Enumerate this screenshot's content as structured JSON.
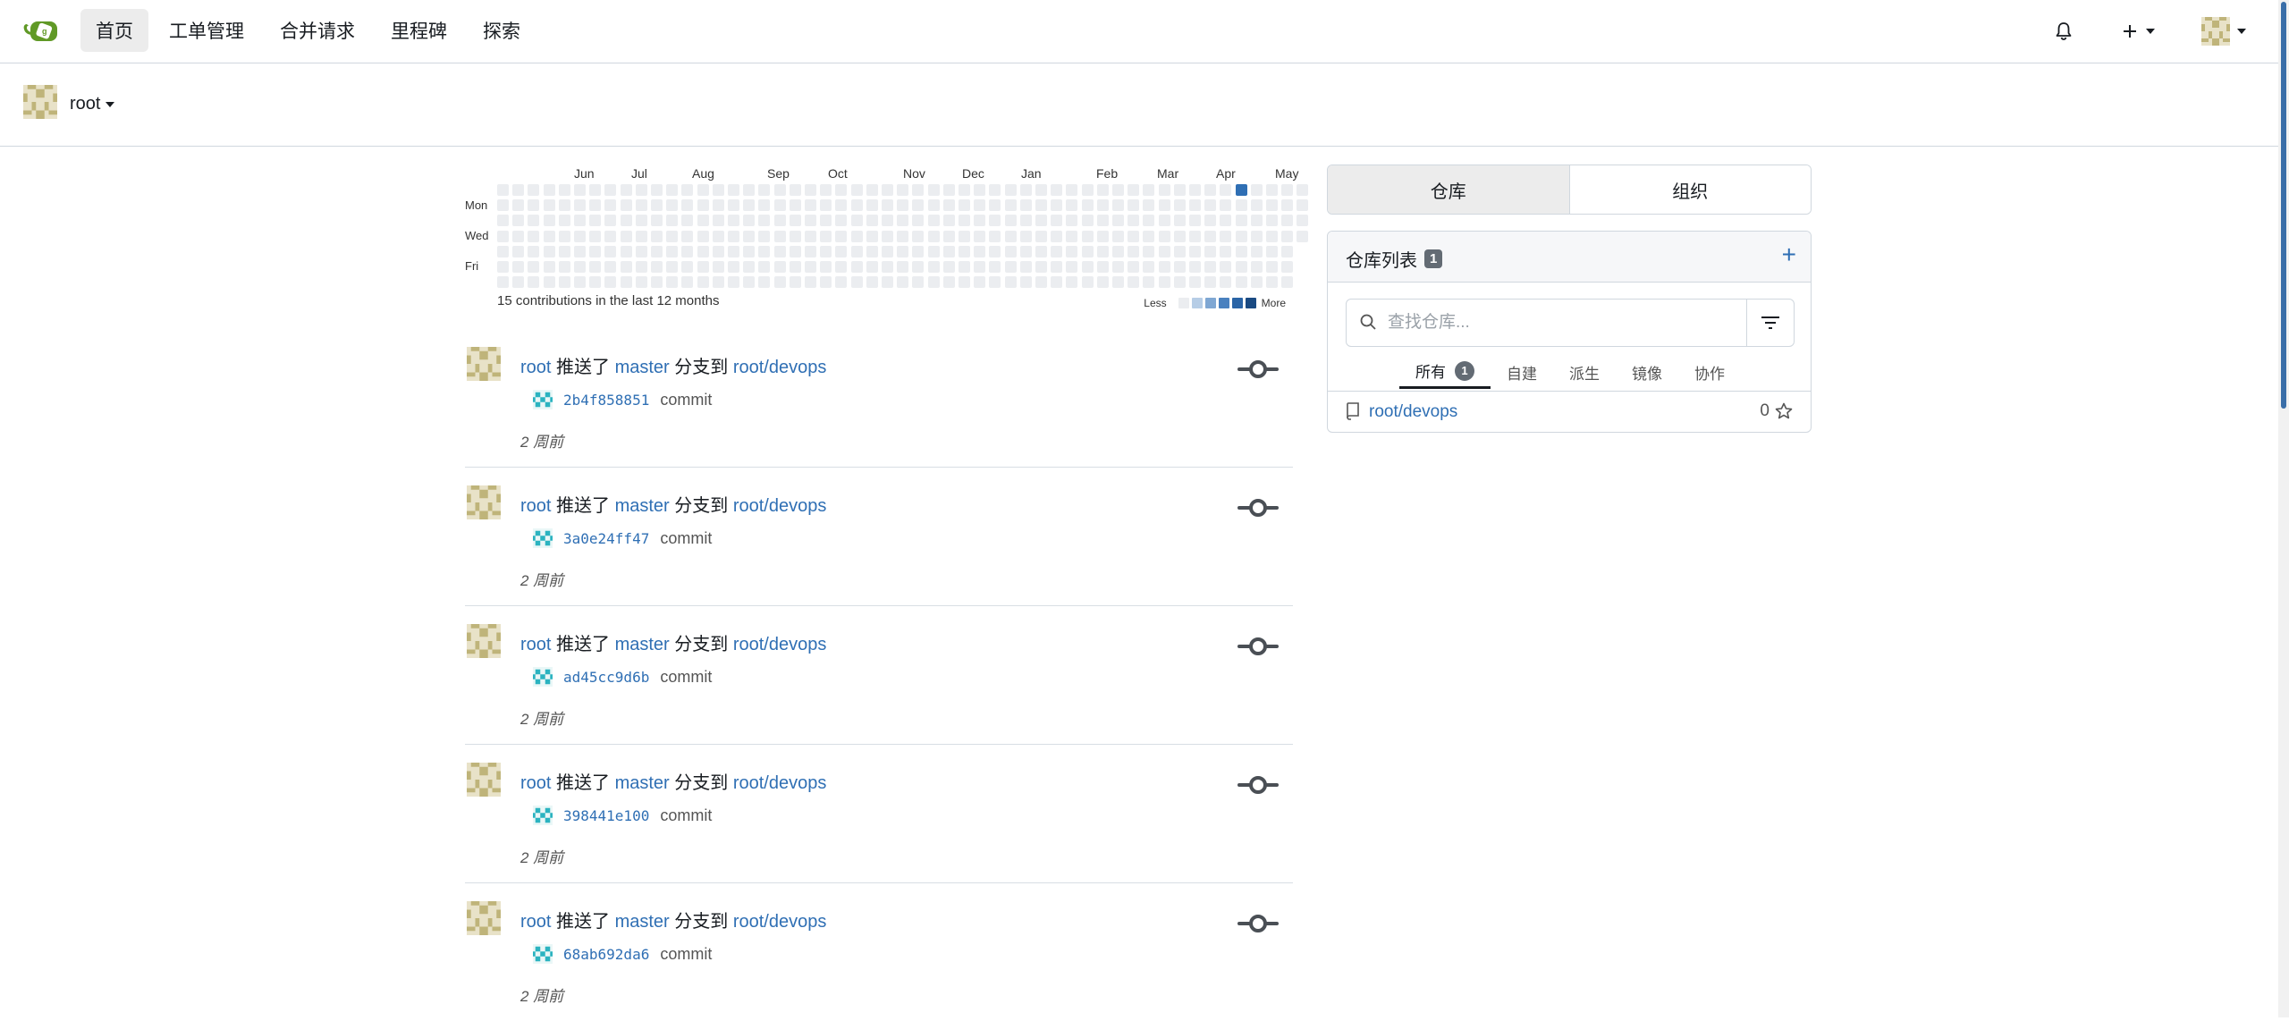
{
  "nav": {
    "items": [
      "首页",
      "工单管理",
      "合并请求",
      "里程碑",
      "探索"
    ],
    "active_index": 0
  },
  "user": {
    "name": "root"
  },
  "heatmap": {
    "months": [
      "Jun",
      "Jul",
      "Aug",
      "Sep",
      "Oct",
      "Nov",
      "Dec",
      "Jan",
      "Feb",
      "Mar",
      "Apr",
      "May"
    ],
    "days": [
      "Mon",
      "Wed",
      "Fri"
    ],
    "total_label": "15 contributions in the last 12 months",
    "legend_less": "Less",
    "legend_more": "More",
    "colors": [
      "#ebedf0",
      "#b6cde6",
      "#7fa7d3",
      "#4a81bf",
      "#2a64a6",
      "#1a4a82"
    ],
    "active_cell_color": "#2f6fb4"
  },
  "feed": [
    {
      "user": "root",
      "action": "推送了",
      "branch": "master",
      "mid": "分支到",
      "repo": "root/devops",
      "sha": "2b4f858851",
      "message": "commit",
      "time": "2 周前"
    },
    {
      "user": "root",
      "action": "推送了",
      "branch": "master",
      "mid": "分支到",
      "repo": "root/devops",
      "sha": "3a0e24ff47",
      "message": "commit",
      "time": "2 周前"
    },
    {
      "user": "root",
      "action": "推送了",
      "branch": "master",
      "mid": "分支到",
      "repo": "root/devops",
      "sha": "ad45cc9d6b",
      "message": "commit",
      "time": "2 周前"
    },
    {
      "user": "root",
      "action": "推送了",
      "branch": "master",
      "mid": "分支到",
      "repo": "root/devops",
      "sha": "398441e100",
      "message": "commit",
      "time": "2 周前"
    },
    {
      "user": "root",
      "action": "推送了",
      "branch": "master",
      "mid": "分支到",
      "repo": "root/devops",
      "sha": "68ab692da6",
      "message": "commit",
      "time": "2 周前"
    }
  ],
  "tabs": [
    "仓库",
    "组织"
  ],
  "repo_panel": {
    "title": "仓库列表",
    "count": "1",
    "add": "+",
    "search_placeholder": "查找仓库...",
    "subtabs": [
      "所有",
      "自建",
      "派生",
      "镜像",
      "协作"
    ],
    "all_count": "1",
    "repo_name": "root/devops",
    "repo_stars": "0"
  },
  "accent_color": "#2f6fb4"
}
